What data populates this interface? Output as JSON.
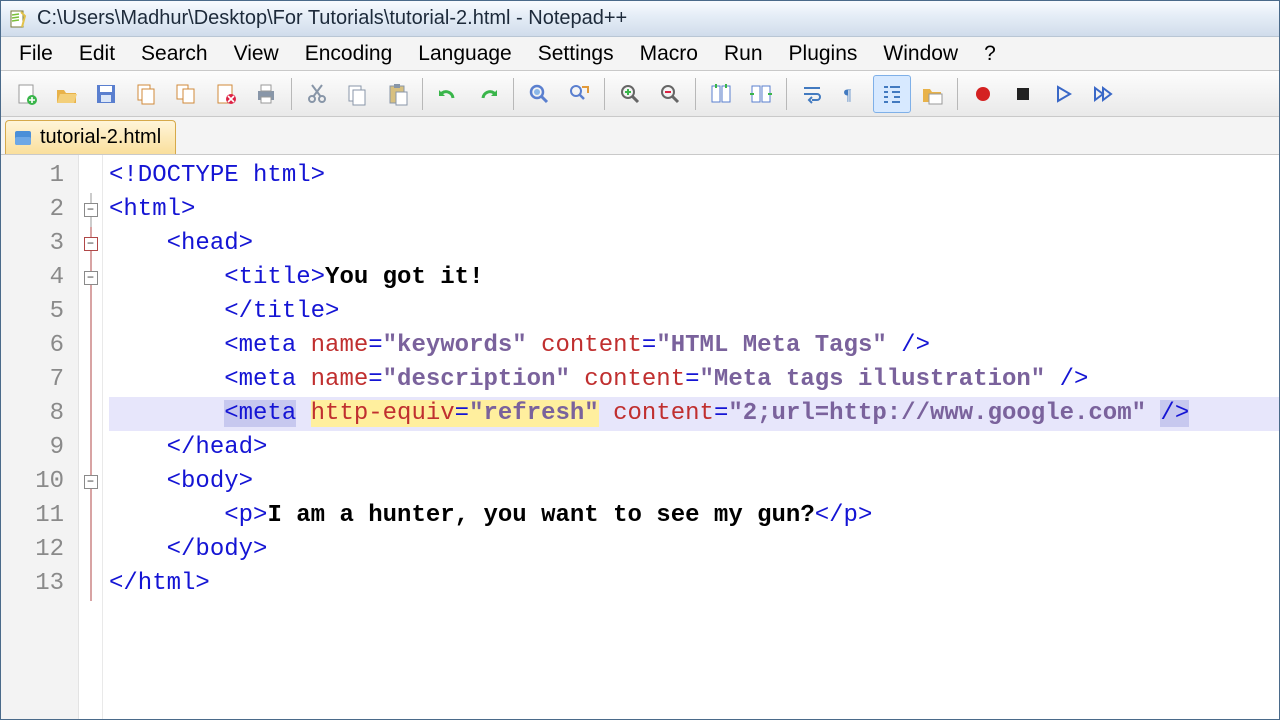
{
  "title": "C:\\Users\\Madhur\\Desktop\\For Tutorials\\tutorial-2.html - Notepad++",
  "menubar": [
    "File",
    "Edit",
    "Search",
    "View",
    "Encoding",
    "Language",
    "Settings",
    "Macro",
    "Run",
    "Plugins",
    "Window",
    "?"
  ],
  "toolbar": {
    "groups": [
      [
        "new",
        "open",
        "save",
        "copy",
        "copy2",
        "close-doc",
        "print"
      ],
      [
        "cut",
        "copy3",
        "paste"
      ],
      [
        "undo",
        "redo"
      ],
      [
        "find",
        "find-replace"
      ],
      [
        "zoom-in",
        "zoom-out"
      ],
      [
        "sync1",
        "sync2"
      ],
      [
        "wrap",
        "show-all",
        "indent-guide",
        "folder"
      ],
      [
        "record",
        "stop",
        "play",
        "fast"
      ]
    ],
    "icons": {
      "new": {
        "name": "new-file-icon",
        "color": "#f5f5f5",
        "accent": "#39b54a"
      },
      "open": {
        "name": "open-folder-icon",
        "color": "#e8b24a"
      },
      "save": {
        "name": "save-disk-icon",
        "color": "#5a7fcf"
      },
      "copy": {
        "name": "copy-icon",
        "color": "#d08a3a"
      },
      "copy2": {
        "name": "copy-all-icon",
        "color": "#d08a3a"
      },
      "close-doc": {
        "name": "close-doc-icon",
        "color": "#d08a3a",
        "accent": "#d24"
      },
      "print": {
        "name": "print-icon",
        "color": "#8896a8"
      },
      "cut": {
        "name": "cut-icon",
        "color": "#8896a8"
      },
      "copy3": {
        "name": "clipboard-copy-icon",
        "color": "#8896a8"
      },
      "paste": {
        "name": "paste-icon",
        "color": "#8896a8"
      },
      "undo": {
        "name": "undo-icon",
        "color": "#39b54a"
      },
      "redo": {
        "name": "redo-icon",
        "color": "#39b54a"
      },
      "find": {
        "name": "find-icon",
        "color": "#5a7fcf"
      },
      "find-replace": {
        "name": "find-replace-icon",
        "color": "#5a7fcf"
      },
      "zoom-in": {
        "name": "zoom-in-icon",
        "color": "#39b54a"
      },
      "zoom-out": {
        "name": "zoom-out-icon",
        "color": "#d24"
      },
      "sync1": {
        "name": "sync-v-icon",
        "color": "#5a7fcf"
      },
      "sync2": {
        "name": "sync-h-icon",
        "color": "#5a7fcf"
      },
      "wrap": {
        "name": "word-wrap-icon",
        "color": "#427ac0"
      },
      "show-all": {
        "name": "show-symbols-icon",
        "color": "#427ac0"
      },
      "indent-guide": {
        "name": "indent-guide-icon",
        "color": "#427ac0",
        "active": true
      },
      "folder": {
        "name": "folder-view-icon",
        "color": "#e8b24a"
      },
      "record": {
        "name": "record-icon",
        "color": "#d42121"
      },
      "stop": {
        "name": "stop-icon",
        "color": "#222"
      },
      "play": {
        "name": "play-icon",
        "color": "#3a68c7"
      },
      "fast": {
        "name": "fast-forward-icon",
        "color": "#3a68c7"
      }
    }
  },
  "tab": {
    "label": "tutorial-2.html"
  },
  "lines": {
    "count": 13,
    "l1": {
      "doctype": "<!DOCTYPE html>"
    },
    "l2": {
      "open": "<html>"
    },
    "l3": {
      "open": "<head>"
    },
    "l4": {
      "open": "<title>",
      "text": "You got it!"
    },
    "l5": {
      "close": "</title>"
    },
    "l6": {
      "tag": "<meta",
      "a1": "name",
      "v1": "\"keywords\"",
      "a2": "content",
      "v2": "\"HTML Meta Tags\"",
      "end": "/>"
    },
    "l7": {
      "tag": "<meta",
      "a1": "name",
      "v1": "\"description\"",
      "a2": "content",
      "v2": "\"Meta tags illustration\"",
      "end": "/>"
    },
    "l8": {
      "tag": "<meta",
      "a1": "http-equiv",
      "v1": "\"refresh\"",
      "a2": "content",
      "v2": "\"2;url=http://www.google.com\"",
      "end": "/>"
    },
    "l9": {
      "close": "</head>"
    },
    "l10": {
      "open": "<body>"
    },
    "l11": {
      "open": "<p>",
      "text": "I am a hunter, you want to see my gun?",
      "close": "</p>"
    },
    "l12": {
      "close": "</body>"
    },
    "l13": {
      "close": "</html>"
    }
  }
}
